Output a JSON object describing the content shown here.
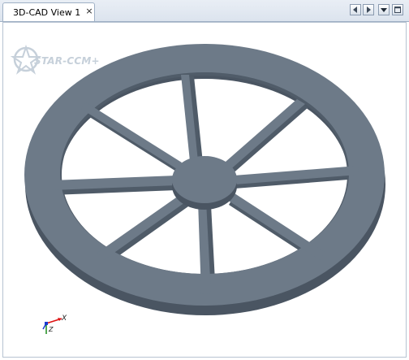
{
  "tabs": [
    {
      "label": "3D-CAD View 1",
      "close": "×"
    }
  ],
  "toolbar": {
    "buttons": [
      {
        "icon": "arrow-left-icon"
      },
      {
        "icon": "arrow-right-icon"
      },
      {
        "icon": "dropdown-icon"
      },
      {
        "icon": "maximize-icon"
      }
    ]
  },
  "viewport": {
    "logo_text": "STAR-CCM+",
    "model_color": "#6d7a88",
    "model_edge_color": "#4a5562",
    "triad": {
      "x_label": "X",
      "z_label": "Z"
    }
  }
}
